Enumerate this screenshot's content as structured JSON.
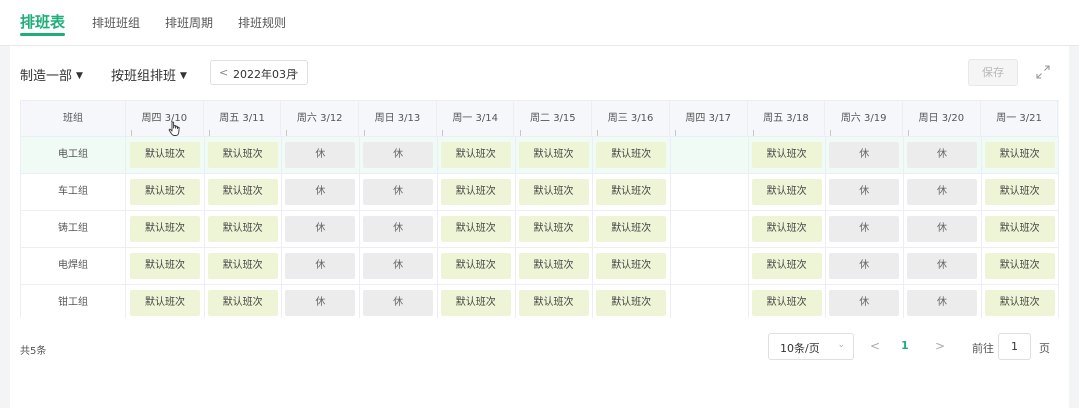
{
  "tabs": [
    {
      "label": "排班表"
    },
    {
      "label": "排班班组"
    },
    {
      "label": "排班周期"
    },
    {
      "label": "排班规则"
    }
  ],
  "toolbar": {
    "department": "制造一部",
    "mode": "按班组排班",
    "month": "2022年03月",
    "save_label": "保存"
  },
  "table": {
    "group_header": "班组",
    "columns": [
      "周四 3/10",
      "周五 3/11",
      "周六 3/12",
      "周日 3/13",
      "周一 3/14",
      "周二 3/15",
      "周三 3/16",
      "周四 3/17",
      "周五 3/18",
      "周六 3/19",
      "周日 3/20",
      "周一 3/21"
    ],
    "rows": [
      {
        "group": "电工组",
        "cells": [
          "默认班次",
          "默认班次",
          "休",
          "休",
          "默认班次",
          "默认班次",
          "默认班次",
          "",
          "默认班次",
          "休",
          "休",
          "默认班次"
        ]
      },
      {
        "group": "车工组",
        "cells": [
          "默认班次",
          "默认班次",
          "休",
          "休",
          "默认班次",
          "默认班次",
          "默认班次",
          "",
          "默认班次",
          "休",
          "休",
          "默认班次"
        ]
      },
      {
        "group": "铸工组",
        "cells": [
          "默认班次",
          "默认班次",
          "休",
          "休",
          "默认班次",
          "默认班次",
          "默认班次",
          "",
          "默认班次",
          "休",
          "休",
          "默认班次"
        ]
      },
      {
        "group": "电焊组",
        "cells": [
          "默认班次",
          "默认班次",
          "休",
          "休",
          "默认班次",
          "默认班次",
          "默认班次",
          "",
          "默认班次",
          "休",
          "休",
          "默认班次"
        ]
      },
      {
        "group": "钳工组",
        "cells": [
          "默认班次",
          "默认班次",
          "休",
          "休",
          "默认班次",
          "默认班次",
          "默认班次",
          "",
          "默认班次",
          "休",
          "休",
          "默认班次"
        ]
      }
    ]
  },
  "footer": {
    "total": "共5条",
    "page_size": "10条/页",
    "current_page": "1",
    "goto_prefix": "前往",
    "goto_value": "1",
    "goto_suffix": "页"
  },
  "colors": {
    "accent": "#1fae7a",
    "work_chip": "#eef5d6",
    "rest_chip": "#ececec",
    "hover_row": "#f1fbf6"
  }
}
